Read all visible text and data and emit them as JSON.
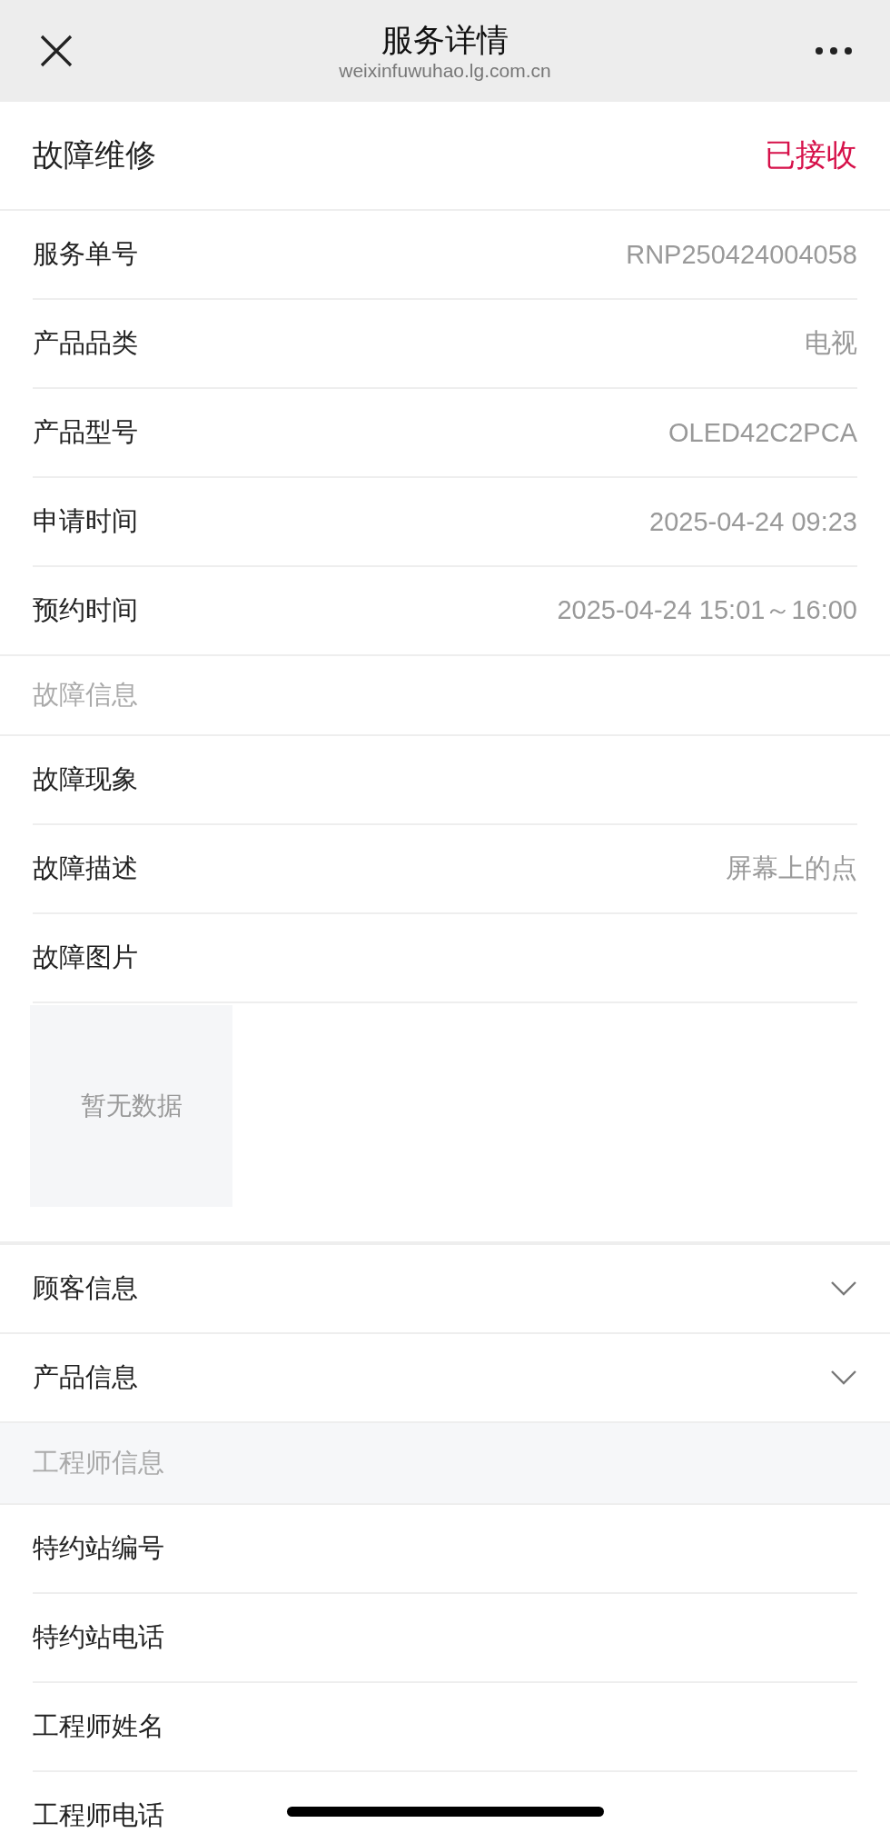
{
  "header": {
    "title": "服务详情",
    "url": "weixinfuwuhao.lg.com.cn"
  },
  "service": {
    "type": "故障维修",
    "status": "已接收"
  },
  "details": [
    {
      "label": "服务单号",
      "value": "RNP250424004058"
    },
    {
      "label": "产品品类",
      "value": "电视"
    },
    {
      "label": "产品型号",
      "value": "OLED42C2PCA"
    },
    {
      "label": "申请时间",
      "value": "2025-04-24 09:23"
    },
    {
      "label": "预约时间",
      "value": "2025-04-24 15:01～16:00"
    }
  ],
  "fault_section": {
    "title": "故障信息",
    "rows": [
      {
        "label": "故障现象"
      },
      {
        "label": "故障描述",
        "value": "屏幕上的点"
      },
      {
        "label": "故障图片"
      }
    ],
    "image_placeholder": "暂无数据"
  },
  "collapsible": [
    {
      "label": "顾客信息",
      "expanded": false
    },
    {
      "label": "产品信息",
      "expanded": false
    }
  ],
  "engineer_section": {
    "title": "工程师信息",
    "rows": [
      {
        "label": "特约站编号"
      },
      {
        "label": "特约站电话"
      },
      {
        "label": "工程师姓名"
      },
      {
        "label": "工程师电话"
      }
    ]
  }
}
